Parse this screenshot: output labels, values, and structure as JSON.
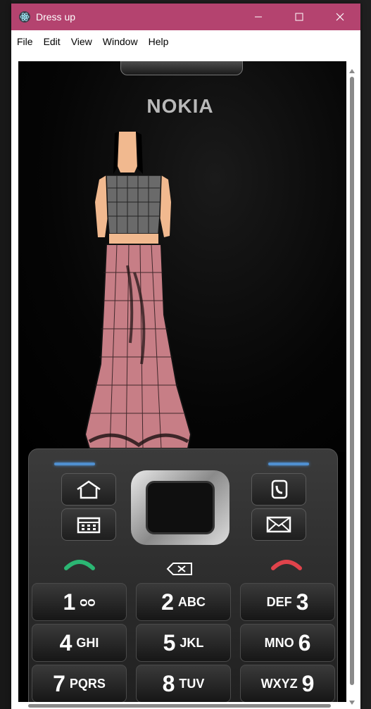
{
  "window": {
    "title": "Dress up"
  },
  "menu": [
    "File",
    "Edit",
    "View",
    "Window",
    "Help"
  ],
  "phone": {
    "brand": "NOKIA",
    "keys": [
      {
        "num": "1",
        "letters": "ᴑᴑ"
      },
      {
        "num": "2",
        "letters": "ABC"
      },
      {
        "num": "3",
        "letters": "DEF"
      },
      {
        "num": "4",
        "letters": "GHI"
      },
      {
        "num": "5",
        "letters": "JKL"
      },
      {
        "num": "6",
        "letters": "MNO"
      },
      {
        "num": "7",
        "letters": "PQRS"
      },
      {
        "num": "8",
        "letters": "TUV"
      },
      {
        "num": "9",
        "letters": "WXYZ"
      }
    ]
  },
  "colors": {
    "titlebar": "#b4436f",
    "led": "#4f8fd0",
    "call_green": "#2bb673",
    "end_red": "#e0434b",
    "skirt": "#c77e86"
  }
}
